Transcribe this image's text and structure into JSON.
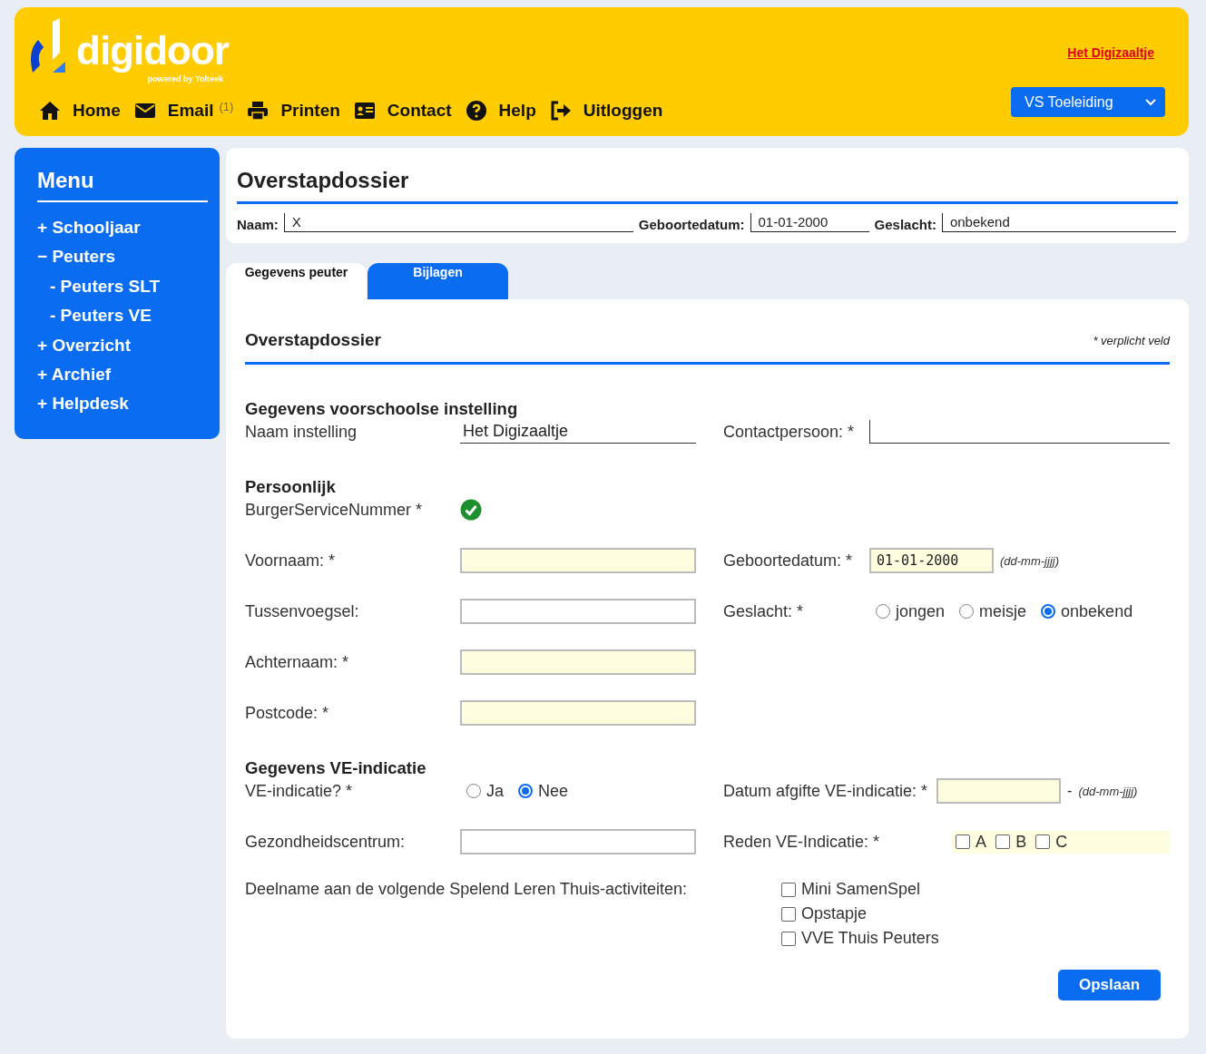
{
  "header": {
    "logo": {
      "name": "digidoor",
      "tagline": "powered by Tolteek"
    },
    "nav": [
      {
        "kind": "home",
        "label": "Home"
      },
      {
        "kind": "mail",
        "label": "Email",
        "count": "(1)"
      },
      {
        "kind": "print",
        "label": "Printen"
      },
      {
        "kind": "card",
        "label": "Contact"
      },
      {
        "kind": "help",
        "label": "Help"
      },
      {
        "kind": "logout",
        "label": "Uitloggen"
      }
    ],
    "link": "Het Digizaaltje",
    "role_select": {
      "value": "VS Toeleiding"
    }
  },
  "sidebar": {
    "title": "Menu",
    "items": [
      {
        "marker": "+",
        "label": "Schooljaar"
      },
      {
        "marker": "−",
        "label": "Peuters",
        "children": [
          {
            "marker": "-",
            "label": "Peuters SLT"
          },
          {
            "marker": "-",
            "label": "Peuters VE"
          }
        ]
      },
      {
        "marker": "+",
        "label": "Overzicht"
      },
      {
        "marker": "+",
        "label": "Archief"
      },
      {
        "marker": "+",
        "label": "Helpdesk"
      }
    ]
  },
  "summary": {
    "title": "Overstapdossier",
    "fields": [
      {
        "label": "Naam:",
        "value": "X"
      },
      {
        "label": "Geboortedatum:",
        "value": "01-01-2000"
      },
      {
        "label": "Geslacht:",
        "value": "onbekend"
      }
    ]
  },
  "tabs": [
    {
      "label": "Gegevens peuter",
      "selected": true
    },
    {
      "label": "Bijlagen",
      "selected": false
    }
  ],
  "form": {
    "title": "Overstapdossier",
    "required_note": "* verplicht veld",
    "sections": [
      {
        "title": "Gegevens voorschoolse instelling",
        "rows": [
          {
            "left": {
              "kind": "line",
              "label": "Naam instelling",
              "value": "Het Digizaaltje"
            },
            "right": {
              "kind": "line",
              "label": "Contactpersoon: *"
            }
          }
        ]
      },
      {
        "title": "Persoonlijk",
        "rows": [
          {
            "left": {
              "kind": "valid",
              "label": "BurgerServiceNummer *"
            }
          },
          {
            "left": {
              "kind": "input",
              "label": "Voornaam: *",
              "required": true
            },
            "right": {
              "kind": "date",
              "label": "Geboortedatum: *",
              "value": "01-01-2000",
              "required": true,
              "hint": "(dd-mm-jjjj)"
            }
          },
          {
            "left": {
              "kind": "input",
              "label": "Tussenvoegsel:",
              "required": false
            },
            "right": {
              "kind": "radios",
              "label": "Geslacht: *",
              "options": [
                {
                  "label": "jongen",
                  "selected": false
                },
                {
                  "label": "meisje",
                  "selected": false
                },
                {
                  "label": "onbekend",
                  "selected": true
                }
              ]
            }
          },
          {
            "left": {
              "kind": "input",
              "label": "Achternaam: *",
              "required": true
            }
          },
          {
            "left": {
              "kind": "input",
              "label": "Postcode: *",
              "required": true
            }
          }
        ]
      },
      {
        "title": "Gegevens VE-indicatie",
        "rows": [
          {
            "left": {
              "kind": "radios",
              "label": "VE-indicatie? *",
              "options": [
                {
                  "label": "Ja",
                  "selected": false
                },
                {
                  "label": "Nee",
                  "selected": true
                }
              ]
            },
            "right": {
              "kind": "date",
              "label": "Datum afgifte VE-indicatie: *",
              "required": true,
              "separator": "-",
              "hint": "(dd-mm-jjjj)"
            }
          },
          {
            "left": {
              "kind": "input",
              "label": "Gezondheidscentrum:",
              "required": false
            },
            "right": {
              "kind": "checkboxes",
              "label": "Reden VE-Indicatie: *",
              "required": true,
              "options": [
                {
                  "label": "A",
                  "checked": false
                },
                {
                  "label": "B",
                  "checked": false
                },
                {
                  "label": "C",
                  "checked": false
                }
              ]
            }
          },
          {
            "left": {
              "kind": "text",
              "label": "Deelname aan de volgende Spelend Leren Thuis-activiteiten:"
            },
            "right": {
              "kind": "checklist",
              "options": [
                {
                  "label": "Mini SamenSpel",
                  "checked": false
                },
                {
                  "label": "Opstapje",
                  "checked": false
                },
                {
                  "label": "VVE Thuis Peuters",
                  "checked": false
                }
              ]
            }
          }
        ]
      }
    ]
  },
  "save_button": "Opslaan"
}
